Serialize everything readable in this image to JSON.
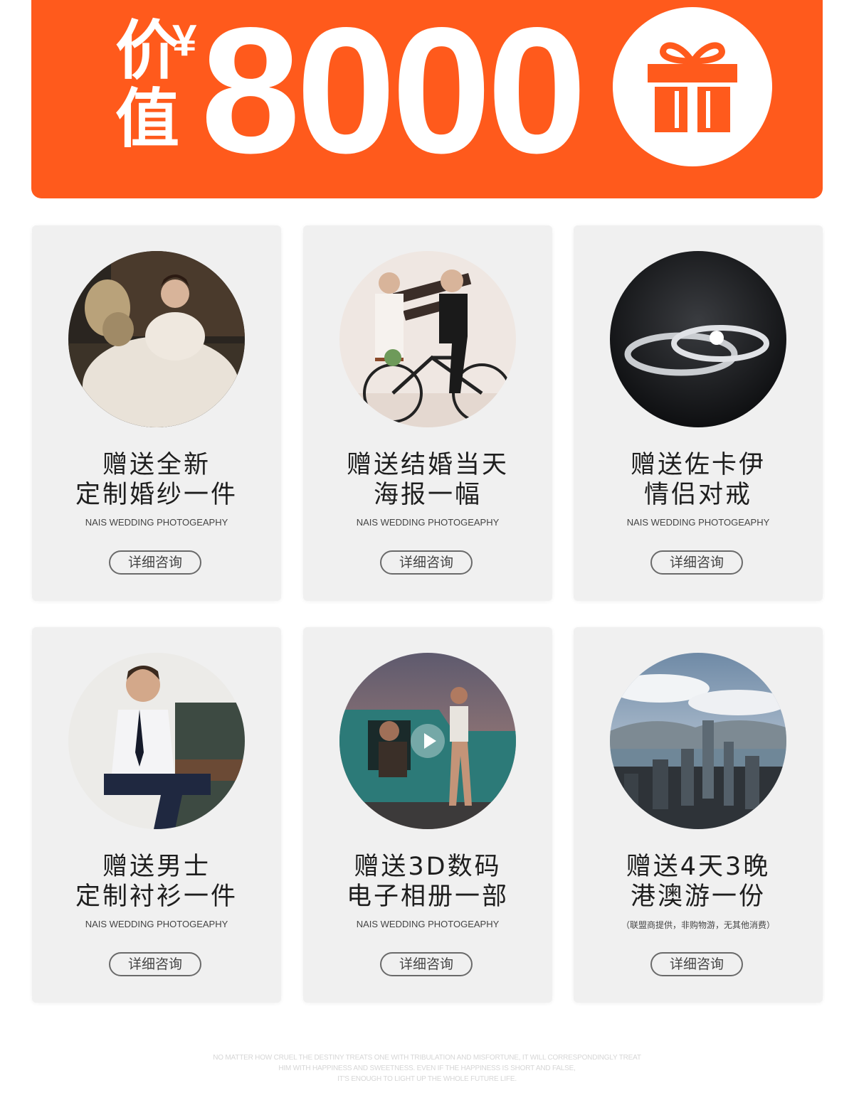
{
  "banner": {
    "label_line1": "价",
    "label_line2": "值",
    "currency": "¥",
    "amount": "8000",
    "icon": "gift-icon",
    "color": "#ff5a1c"
  },
  "cards": [
    {
      "photo": "bride-in-wedding-dress-photo",
      "title_line1": "赠送全新",
      "title_line2": "定制婚纱一件",
      "subtitle": "NAIS WEDDING PHOTOGEAPHY",
      "button": "详细咨询"
    },
    {
      "photo": "couple-on-bicycle-photo",
      "title_line1": "赠送结婚当天",
      "title_line2": "海报一幅",
      "subtitle": "NAIS WEDDING PHOTOGEAPHY",
      "button": "详细咨询"
    },
    {
      "photo": "wedding-rings-photo",
      "title_line1": "赠送佐卡伊",
      "title_line2": "情侣对戒",
      "subtitle": "NAIS WEDDING PHOTOGEAPHY",
      "button": "详细咨询"
    },
    {
      "photo": "man-in-shirt-photo",
      "title_line1": "赠送男士",
      "title_line2": "定制衬衫一件",
      "subtitle": "NAIS WEDDING PHOTOGEAPHY",
      "button": "详细咨询"
    },
    {
      "photo": "couple-with-car-video",
      "title_line1": "赠送3D数码",
      "title_line2": "电子相册一部",
      "subtitle": "NAIS WEDDING PHOTOGEAPHY",
      "button": "详细咨询"
    },
    {
      "photo": "city-skyline-photo",
      "title_line1": "赠送4天3晚",
      "title_line2": "港澳游一份",
      "subtitle": "（联盟商提供，非购物游，无其他消费）",
      "button": "详细咨询"
    }
  ],
  "footer": {
    "line1": "NO MATTER HOW CRUEL THE DESTINY TREATS ONE WITH TRIBULATION AND MISFORTUNE, IT WILL CORRESPONDINGLY TREAT",
    "line2": "HIM WITH HAPPINESS AND SWEETNESS. EVEN IF THE HAPPINESS IS SHORT AND FALSE,",
    "line3": "IT'S ENOUGH TO LIGHT UP THE WHOLE FUTURE LIFE."
  }
}
